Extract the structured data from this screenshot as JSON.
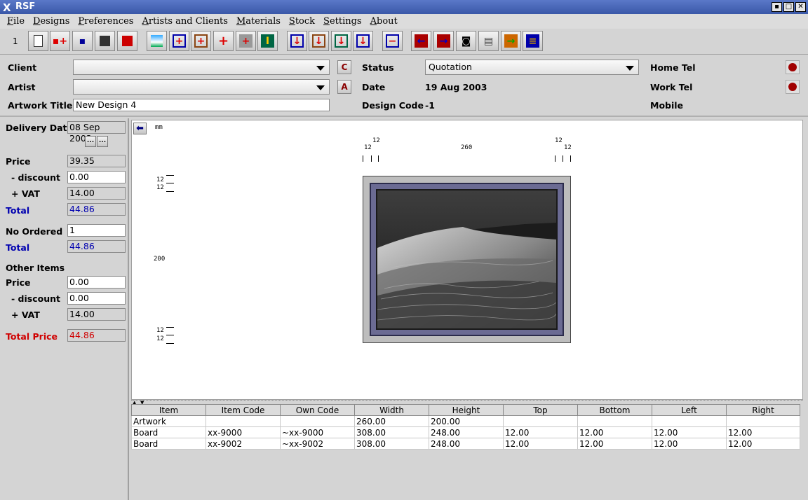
{
  "window": {
    "title": "RSF"
  },
  "menu": [
    "File",
    "Designs",
    "Preferences",
    "Artists and Clients",
    "Materials",
    "Stock",
    "Settings",
    "About"
  ],
  "toolbar": {
    "number": "1"
  },
  "header": {
    "client_label": "Client",
    "client_value": "",
    "artist_label": "Artist",
    "artist_value": "",
    "artwork_title_label": "Artwork Title",
    "artwork_title_value": "New Design 4",
    "status_label": "Status",
    "status_value": "Quotation",
    "date_label": "Date",
    "date_value": "19 Aug 2003",
    "design_code_label": "Design Code",
    "design_code_value": "-1",
    "home_tel_label": "Home Tel",
    "work_tel_label": "Work Tel",
    "mobile_label": "Mobile"
  },
  "left": {
    "delivery_date_label": "Delivery Date",
    "delivery_date_value": "08 Sep 2003",
    "dots_label": "...",
    "price_label": "Price",
    "price_value": "39.35",
    "discount_label": "- discount",
    "discount_value": "0.00",
    "vat_label": "+ VAT",
    "vat_value": "14.00",
    "total_label": "Total",
    "total_value": "44.86",
    "no_ordered_label": "No Ordered",
    "no_ordered_value": "1",
    "total2_label": "Total",
    "total2_value": "44.86",
    "other_items_label": "Other Items",
    "other_price_label": "Price",
    "other_price_value": "0.00",
    "other_discount_label": "- discount",
    "other_discount_value": "0.00",
    "other_vat_label": "+ VAT",
    "other_vat_value": "14.00",
    "total_price_label": "Total Price",
    "total_price_value": "44.86"
  },
  "canvas": {
    "unit": "mm",
    "top_left_12a": "12",
    "top_left_12b": "12",
    "top_width": "260",
    "top_right_12a": "12",
    "top_right_12b": "12",
    "left_12a": "12",
    "left_12b": "12",
    "left_height": "200",
    "left_12c": "12",
    "left_12d": "12"
  },
  "table": {
    "headers": [
      "Item",
      "Item Code",
      "Own Code",
      "Width",
      "Height",
      "Top",
      "Bottom",
      "Left",
      "Right"
    ],
    "rows": [
      [
        "Artwork",
        "",
        "",
        "260.00",
        "200.00",
        "",
        "",
        "",
        ""
      ],
      [
        "Board",
        "xx-9000",
        "~xx-9000",
        "308.00",
        "248.00",
        "12.00",
        "12.00",
        "12.00",
        "12.00"
      ],
      [
        "Board",
        "xx-9002",
        "~xx-9002",
        "308.00",
        "248.00",
        "12.00",
        "12.00",
        "12.00",
        "12.00"
      ]
    ]
  }
}
